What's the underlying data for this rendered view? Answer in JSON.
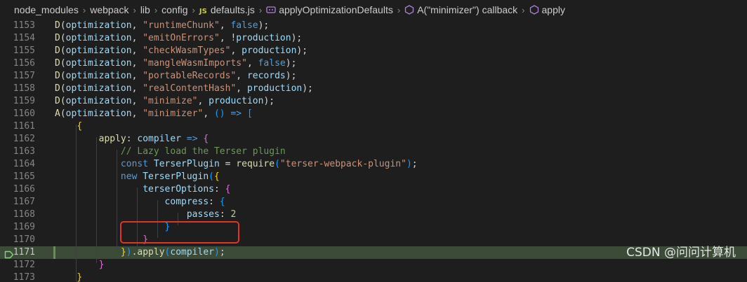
{
  "breadcrumb": {
    "segments": [
      "node_modules",
      "webpack",
      "lib",
      "config"
    ],
    "file_badge": "JS",
    "file": "defaults.js",
    "symbols": [
      "applyOptimizationDefaults",
      "A(\"minimizer\") callback",
      "apply"
    ]
  },
  "editor": {
    "current_line": 1171,
    "lines": [
      {
        "num": "1153",
        "tokens": [
          [
            "fn",
            "D"
          ],
          [
            "p",
            "("
          ],
          [
            "var",
            "optimization"
          ],
          [
            "p",
            ", "
          ],
          [
            "str",
            "\"runtimeChunk\""
          ],
          [
            "p",
            ", "
          ],
          [
            "kw",
            "false"
          ],
          [
            "p",
            ");"
          ]
        ]
      },
      {
        "num": "1154",
        "tokens": [
          [
            "fn",
            "D"
          ],
          [
            "p",
            "("
          ],
          [
            "var",
            "optimization"
          ],
          [
            "p",
            ", "
          ],
          [
            "str",
            "\"emitOnErrors\""
          ],
          [
            "p",
            ", !"
          ],
          [
            "var",
            "production"
          ],
          [
            "p",
            ");"
          ]
        ]
      },
      {
        "num": "1155",
        "tokens": [
          [
            "fn",
            "D"
          ],
          [
            "p",
            "("
          ],
          [
            "var",
            "optimization"
          ],
          [
            "p",
            ", "
          ],
          [
            "str",
            "\"checkWasmTypes\""
          ],
          [
            "p",
            ", "
          ],
          [
            "var",
            "production"
          ],
          [
            "p",
            ");"
          ]
        ]
      },
      {
        "num": "1156",
        "tokens": [
          [
            "fn",
            "D"
          ],
          [
            "p",
            "("
          ],
          [
            "var",
            "optimization"
          ],
          [
            "p",
            ", "
          ],
          [
            "str",
            "\"mangleWasmImports\""
          ],
          [
            "p",
            ", "
          ],
          [
            "kw",
            "false"
          ],
          [
            "p",
            ");"
          ]
        ]
      },
      {
        "num": "1157",
        "tokens": [
          [
            "fn",
            "D"
          ],
          [
            "p",
            "("
          ],
          [
            "var",
            "optimization"
          ],
          [
            "p",
            ", "
          ],
          [
            "str",
            "\"portableRecords\""
          ],
          [
            "p",
            ", "
          ],
          [
            "var",
            "records"
          ],
          [
            "p",
            ");"
          ]
        ]
      },
      {
        "num": "1158",
        "tokens": [
          [
            "fn",
            "D"
          ],
          [
            "p",
            "("
          ],
          [
            "var",
            "optimization"
          ],
          [
            "p",
            ", "
          ],
          [
            "str",
            "\"realContentHash\""
          ],
          [
            "p",
            ", "
          ],
          [
            "var",
            "production"
          ],
          [
            "p",
            ");"
          ]
        ]
      },
      {
        "num": "1159",
        "tokens": [
          [
            "fn",
            "D"
          ],
          [
            "p",
            "("
          ],
          [
            "var",
            "optimization"
          ],
          [
            "p",
            ", "
          ],
          [
            "str",
            "\"minimize\""
          ],
          [
            "p",
            ", "
          ],
          [
            "var",
            "production"
          ],
          [
            "p",
            ");"
          ]
        ]
      },
      {
        "num": "1160",
        "tokens": [
          [
            "fn",
            "A"
          ],
          [
            "p",
            "("
          ],
          [
            "var",
            "optimization"
          ],
          [
            "p",
            ", "
          ],
          [
            "str",
            "\"minimizer\""
          ],
          [
            "p",
            ", "
          ],
          [
            "b3",
            "()"
          ],
          [
            "p",
            " "
          ],
          [
            "kw",
            "=>"
          ],
          [
            "p",
            " "
          ],
          [
            "b3",
            "["
          ]
        ]
      },
      {
        "num": "1161",
        "tokens": [
          [
            "p",
            "    "
          ],
          [
            "b1",
            "{"
          ]
        ]
      },
      {
        "num": "1162",
        "tokens": [
          [
            "p",
            "        "
          ],
          [
            "fn",
            "apply"
          ],
          [
            "p",
            ": "
          ],
          [
            "var",
            "compiler"
          ],
          [
            "p",
            " "
          ],
          [
            "kw",
            "=>"
          ],
          [
            "p",
            " "
          ],
          [
            "b2",
            "{"
          ]
        ]
      },
      {
        "num": "1163",
        "tokens": [
          [
            "p",
            "            "
          ],
          [
            "cm",
            "// Lazy load the Terser plugin"
          ]
        ]
      },
      {
        "num": "1164",
        "tokens": [
          [
            "p",
            "            "
          ],
          [
            "kw",
            "const"
          ],
          [
            "p",
            " "
          ],
          [
            "var",
            "TerserPlugin"
          ],
          [
            "p",
            " = "
          ],
          [
            "fn",
            "require"
          ],
          [
            "b3",
            "("
          ],
          [
            "str",
            "\"terser-webpack-plugin\""
          ],
          [
            "b3",
            ")"
          ],
          [
            "p",
            ";"
          ]
        ]
      },
      {
        "num": "1165",
        "tokens": [
          [
            "p",
            "            "
          ],
          [
            "kw",
            "new"
          ],
          [
            "p",
            " "
          ],
          [
            "var",
            "TerserPlugin"
          ],
          [
            "b3",
            "("
          ],
          [
            "b1",
            "{"
          ]
        ]
      },
      {
        "num": "1166",
        "tokens": [
          [
            "p",
            "                "
          ],
          [
            "var",
            "terserOptions"
          ],
          [
            "p",
            ": "
          ],
          [
            "b2",
            "{"
          ]
        ]
      },
      {
        "num": "1167",
        "tokens": [
          [
            "p",
            "                    "
          ],
          [
            "var",
            "compress"
          ],
          [
            "p",
            ": "
          ],
          [
            "b3",
            "{"
          ]
        ]
      },
      {
        "num": "1168",
        "tokens": [
          [
            "p",
            "                        "
          ],
          [
            "var",
            "passes"
          ],
          [
            "p",
            ": "
          ],
          [
            "num",
            "2"
          ]
        ]
      },
      {
        "num": "1169",
        "tokens": [
          [
            "p",
            "                    "
          ],
          [
            "b3",
            "}"
          ]
        ]
      },
      {
        "num": "1170",
        "tokens": [
          [
            "p",
            "                "
          ],
          [
            "b2",
            "}"
          ]
        ]
      },
      {
        "num": "1171",
        "tokens": [
          [
            "p",
            "            "
          ],
          [
            "b1",
            "}"
          ],
          [
            "b3",
            ")"
          ],
          [
            "p",
            "."
          ],
          [
            "fn",
            "apply"
          ],
          [
            "b3",
            "("
          ],
          [
            "var",
            "compiler"
          ],
          [
            "b3",
            ")"
          ],
          [
            "p",
            ";"
          ]
        ]
      },
      {
        "num": "1172",
        "tokens": [
          [
            "p",
            "        "
          ],
          [
            "b2",
            "}"
          ]
        ]
      },
      {
        "num": "1173",
        "tokens": [
          [
            "p",
            "    "
          ],
          [
            "b1",
            "}"
          ]
        ]
      }
    ]
  },
  "watermark": "CSDN @问问计算机",
  "colors": {
    "background": "#1e1e1e",
    "current_line": "#3b4b38",
    "highlight_box": "#e0352b"
  }
}
